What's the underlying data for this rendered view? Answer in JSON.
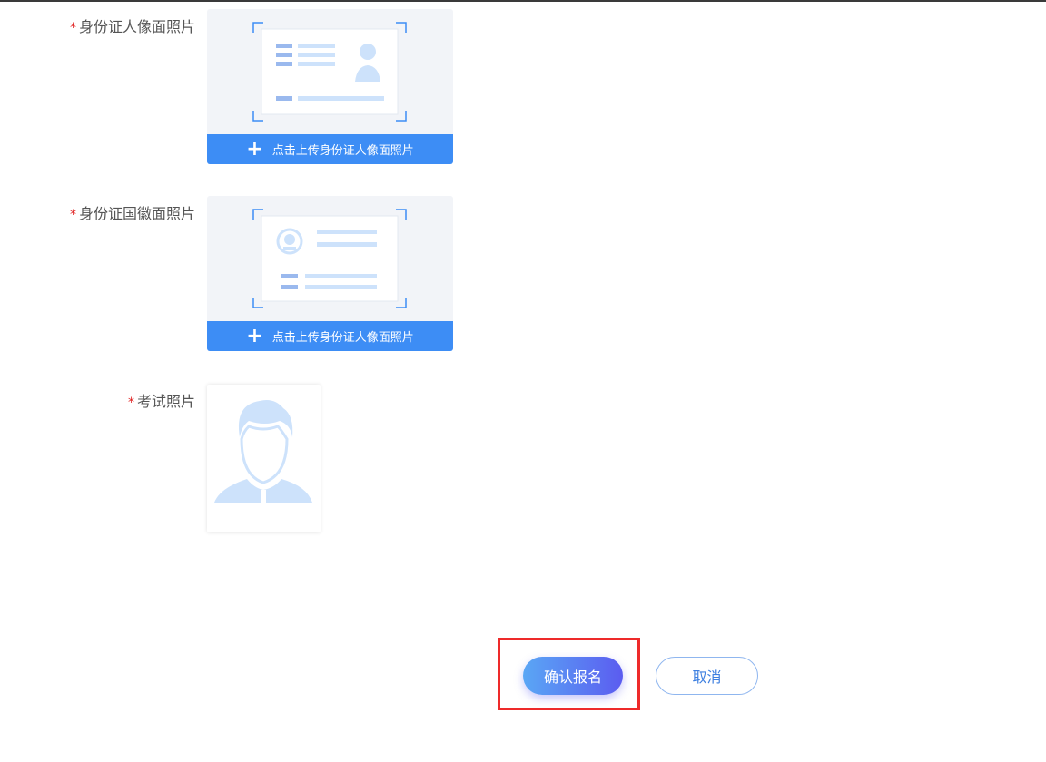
{
  "form": {
    "required_mark": "*",
    "id_front": {
      "label": "身份证人像面照片",
      "upload_text": "点击上传身份证人像面照片",
      "icon": "id-card-front-icon"
    },
    "id_back": {
      "label": "身份证国徽面照片",
      "upload_text": "点击上传身份证人像面照片",
      "icon": "id-card-back-icon"
    },
    "exam_photo": {
      "label": "考试照片",
      "icon": "portrait-placeholder-icon"
    }
  },
  "actions": {
    "confirm_label": "确认报名",
    "cancel_label": "取消"
  },
  "colors": {
    "accent": "#3d8df5",
    "required": "#e02020",
    "highlight": "#ee2a2a"
  }
}
